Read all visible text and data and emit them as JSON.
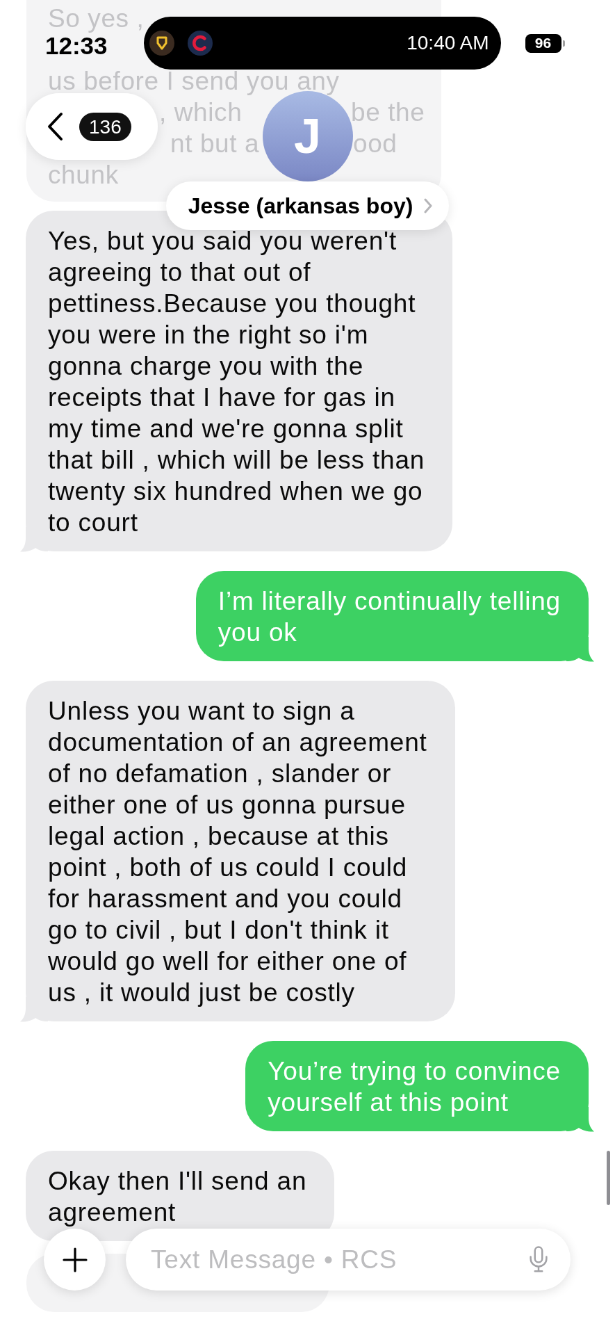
{
  "status_bar": {
    "time": "12:33",
    "battery": "96"
  },
  "live_activity": {
    "time": "10:40 AM"
  },
  "header": {
    "back_badge": "136",
    "avatar_initial": "J",
    "contact_name": "Jesse (arkansas boy)"
  },
  "partial_message": {
    "lines": [
      [
        "So yes ,"
      ],
      [
        "us before I send you any"
      ],
      [
        ", which",
        "be the"
      ],
      [
        "nt but a",
        "ood"
      ],
      [
        "chunk"
      ]
    ]
  },
  "messages": [
    {
      "kind": "incoming",
      "tail": true,
      "lines": [
        "Yes, but you said you weren't",
        "agreeing to that out of",
        "pettiness.Because you thought",
        "you were in the right so i'm",
        "gonna charge you with the",
        "receipts that I have for gas in",
        "my time and we're gonna split",
        "that bill , which will be less than",
        "twenty six hundred when we go",
        "to court"
      ]
    },
    {
      "kind": "outgoing",
      "tail": true,
      "lines": [
        "I’m literally continually telling",
        "you ok"
      ]
    },
    {
      "kind": "incoming",
      "tail": true,
      "lines": [
        "Unless you want to sign a",
        "documentation of an agreement",
        "of no defamation , slander or",
        "either one of us gonna pursue",
        "legal action , because at this",
        "point , both of us could I could",
        "for harassment and you could",
        "go to civil , but I don't think it",
        "would go well for either one of",
        "us , it would just be costly"
      ]
    },
    {
      "kind": "outgoing",
      "tail": true,
      "lines": [
        "You’re trying to convince",
        "yourself at this point"
      ]
    },
    {
      "kind": "incoming",
      "tail": false,
      "lines": [
        "Okay then I'll send an",
        "agreement"
      ]
    }
  ],
  "composer": {
    "placeholder": "Text Message • RCS"
  }
}
